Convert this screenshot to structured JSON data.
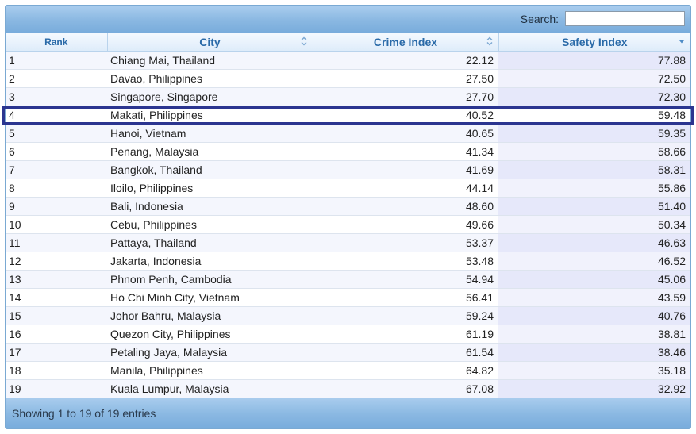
{
  "search": {
    "label": "Search:",
    "value": "",
    "placeholder": ""
  },
  "columns": {
    "rank": "Rank",
    "city": "City",
    "crime": "Crime Index",
    "safety": "Safety Index"
  },
  "sort": {
    "column": "Safety Index",
    "direction": "descending"
  },
  "rows": [
    {
      "rank": "1",
      "city": "Chiang Mai, Thailand",
      "crime": "22.12",
      "safety": "77.88"
    },
    {
      "rank": "2",
      "city": "Davao, Philippines",
      "crime": "27.50",
      "safety": "72.50"
    },
    {
      "rank": "3",
      "city": "Singapore, Singapore",
      "crime": "27.70",
      "safety": "72.30"
    },
    {
      "rank": "4",
      "city": "Makati, Philippines",
      "crime": "40.52",
      "safety": "59.48"
    },
    {
      "rank": "5",
      "city": "Hanoi, Vietnam",
      "crime": "40.65",
      "safety": "59.35"
    },
    {
      "rank": "6",
      "city": "Penang, Malaysia",
      "crime": "41.34",
      "safety": "58.66"
    },
    {
      "rank": "7",
      "city": "Bangkok, Thailand",
      "crime": "41.69",
      "safety": "58.31"
    },
    {
      "rank": "8",
      "city": "Iloilo, Philippines",
      "crime": "44.14",
      "safety": "55.86"
    },
    {
      "rank": "9",
      "city": "Bali, Indonesia",
      "crime": "48.60",
      "safety": "51.40"
    },
    {
      "rank": "10",
      "city": "Cebu, Philippines",
      "crime": "49.66",
      "safety": "50.34"
    },
    {
      "rank": "11",
      "city": "Pattaya, Thailand",
      "crime": "53.37",
      "safety": "46.63"
    },
    {
      "rank": "12",
      "city": "Jakarta, Indonesia",
      "crime": "53.48",
      "safety": "46.52"
    },
    {
      "rank": "13",
      "city": "Phnom Penh, Cambodia",
      "crime": "54.94",
      "safety": "45.06"
    },
    {
      "rank": "14",
      "city": "Ho Chi Minh City, Vietnam",
      "crime": "56.41",
      "safety": "43.59"
    },
    {
      "rank": "15",
      "city": "Johor Bahru, Malaysia",
      "crime": "59.24",
      "safety": "40.76"
    },
    {
      "rank": "16",
      "city": "Quezon City, Philippines",
      "crime": "61.19",
      "safety": "38.81"
    },
    {
      "rank": "17",
      "city": "Petaling Jaya, Malaysia",
      "crime": "61.54",
      "safety": "38.46"
    },
    {
      "rank": "18",
      "city": "Manila, Philippines",
      "crime": "64.82",
      "safety": "35.18"
    },
    {
      "rank": "19",
      "city": "Kuala Lumpur, Malaysia",
      "crime": "67.08",
      "safety": "32.92"
    }
  ],
  "highlighted_rank": "4",
  "footer": {
    "info": "Showing 1 to 19 of 19 entries"
  },
  "colors": {
    "header_text": "#2a6aa8",
    "highlight_border": "#2b3590",
    "toolbar": "#8ab8e2"
  }
}
